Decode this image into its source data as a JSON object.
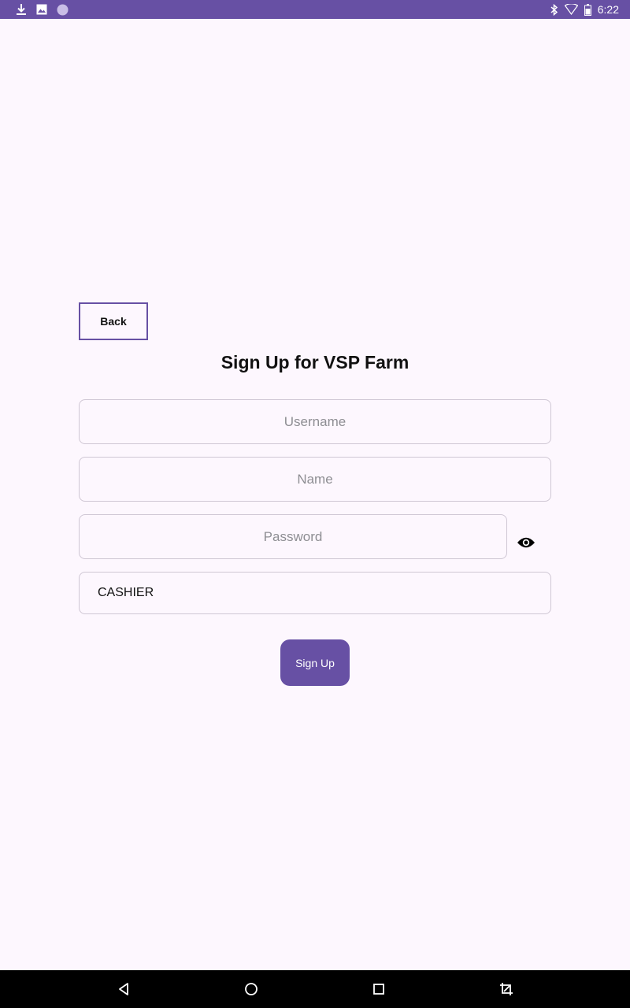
{
  "status_bar": {
    "time": "6:22",
    "left_icons": [
      "download-icon",
      "image-icon",
      "sync-circle-icon"
    ],
    "right_icons": [
      "bluetooth-icon",
      "wifi-icon",
      "battery-icon"
    ],
    "color": "#6750A4"
  },
  "form": {
    "back_label": "Back",
    "title": "Sign Up for VSP Farm",
    "username_placeholder": "Username",
    "name_placeholder": "Name",
    "password_placeholder": "Password",
    "password_toggle_icon": "eye-icon",
    "role_value": "CASHIER",
    "submit_label": "Sign Up"
  },
  "nav_bar": {
    "buttons": [
      "back-triangle-icon",
      "home-circle-icon",
      "recents-square-icon",
      "screenshot-edit-icon"
    ]
  },
  "colors": {
    "accent": "#6750A4",
    "background": "#FDF7FE",
    "field_border": "#CFC7D4"
  }
}
